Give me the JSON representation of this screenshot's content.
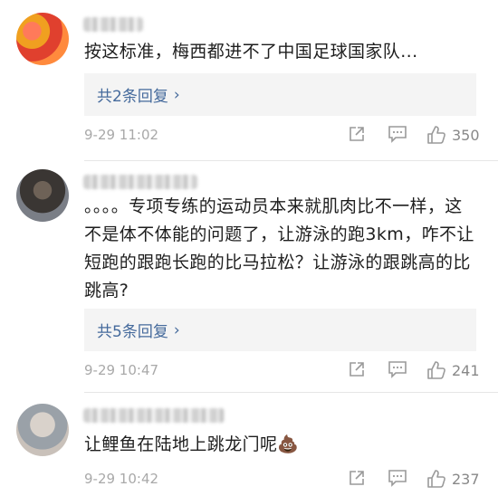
{
  "comments": [
    {
      "text": "按这标准，梅西都进不了中国足球国家队...",
      "replies": "共2条回复",
      "time": "9-29 11:02",
      "likes": "350"
    },
    {
      "text": "。。。。专项专练的运动员本来就肌肉比不一样，这不是体不体能的问题了，让游泳的跑3km，咋不让短跑的跟跑长跑的比马拉松？让游泳的跟跳高的比跳高?",
      "replies": "共5条回复",
      "time": "9-29 10:47",
      "likes": "241"
    },
    {
      "text": "让鲤鱼在陆地上跳龙门呢💩",
      "time": "9-29 10:42",
      "likes": "237"
    }
  ],
  "icons": {
    "reply_chevron": "chevron-right-icon",
    "share": "share-icon",
    "comment": "comment-icon",
    "like": "thumbs-up-icon"
  },
  "colors": {
    "link": "#456a9c",
    "meta": "#a9a9a9",
    "reply_bg": "#f4f4f4"
  }
}
